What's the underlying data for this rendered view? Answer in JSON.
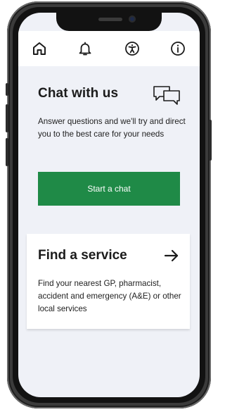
{
  "nav": {
    "items": [
      {
        "icon": "home-icon"
      },
      {
        "icon": "bell-icon"
      },
      {
        "icon": "accessibility-icon"
      },
      {
        "icon": "info-icon"
      }
    ]
  },
  "chat": {
    "title": "Chat with us",
    "icon": "speech-bubbles-icon",
    "description": "Answer questions and we'll try and direct you to the best care for your needs",
    "button_label": "Start a chat"
  },
  "service": {
    "title": "Find a service",
    "icon": "arrow-right-icon",
    "description": "Find your nearest GP, pharmacist, accident and emergency (A&E) or other local services"
  },
  "colors": {
    "background": "#eff1f7",
    "button": "#1f8a47",
    "text": "#1b1b1b",
    "frame": "#3b3b3b"
  }
}
